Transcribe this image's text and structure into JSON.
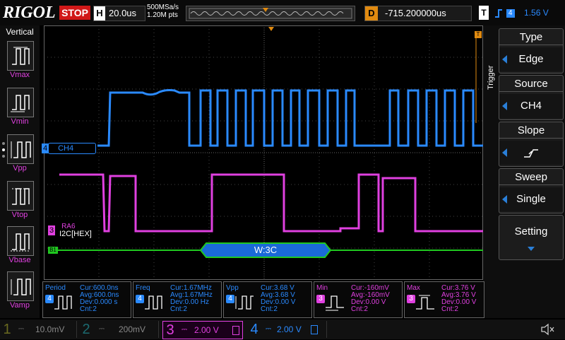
{
  "header": {
    "brand": "RIGOL",
    "run_status": "STOP",
    "timebase_key": "H",
    "timebase_value": "20.0us",
    "sample_rate": "500MSa/s",
    "memory_depth": "1.20M pts",
    "delay_key": "D",
    "delay_value": "-715.200000us",
    "trigger_key": "T",
    "trigger_source": "4",
    "trigger_level": "1.56 V"
  },
  "vertical_panel": {
    "title": "Vertical",
    "items": [
      {
        "label": "Vmax"
      },
      {
        "label": "Vmin"
      },
      {
        "label": "Vpp"
      },
      {
        "label": "Vtop"
      },
      {
        "label": "Vbase"
      },
      {
        "label": "Vamp"
      }
    ]
  },
  "display": {
    "ch4_label": "CH4",
    "ch4_marker": "4",
    "ch3_label": "RA6",
    "ch3_marker": "3",
    "decode_label": "I2C[HEX]",
    "bus_marker": "B1",
    "bus_packet": "W:3C",
    "trig_pos_marker": "T",
    "trig_level_marker": "T"
  },
  "trigger_menu": {
    "title": "Trigger",
    "items": [
      {
        "title": "Type",
        "value": "Edge"
      },
      {
        "title": "Source",
        "value": "CH4"
      },
      {
        "title": "Slope",
        "value": ""
      },
      {
        "title": "Sweep",
        "value": "Single"
      },
      {
        "title": "Setting",
        "value": ""
      }
    ]
  },
  "measurements": [
    {
      "name": "Period",
      "source": "4",
      "cur": "Cur:600.0ns",
      "avg": "Avg:600.0ns",
      "dev": "Dev:0.000 s",
      "cnt": "Cnt:2",
      "color": "#2a8aff"
    },
    {
      "name": "Freq",
      "source": "4",
      "cur": "Cur:1.67MHz",
      "avg": "Avg:1.67MHz",
      "dev": "Dev:0.00 Hz",
      "cnt": "Cnt:2",
      "color": "#2a8aff"
    },
    {
      "name": "Vpp",
      "source": "4",
      "cur": "Cur:3.68 V",
      "avg": "Avg:3.68 V",
      "dev": "Dev:0.00 V",
      "cnt": "Cnt:2",
      "color": "#2a8aff"
    },
    {
      "name": "Min",
      "source": "3",
      "cur": "Cur:-160mV",
      "avg": "Avg:-160mV",
      "dev": "Dev:0.00 V",
      "cnt": "Cnt:2",
      "color": "#e040e0"
    },
    {
      "name": "Max",
      "source": "3",
      "cur": "Cur:3.76 V",
      "avg": "Avg:3.76 V",
      "dev": "Dev:0.00 V",
      "cnt": "Cnt:2",
      "color": "#e040e0"
    }
  ],
  "channels": [
    {
      "num": "1",
      "scale": "10.0mV",
      "color": "#d8c800"
    },
    {
      "num": "2",
      "scale": "200mV",
      "color": "#20c8d8"
    },
    {
      "num": "3",
      "scale": "2.00 V",
      "color": "#e040e0"
    },
    {
      "num": "4",
      "scale": "2.00 V",
      "color": "#2a8aff"
    }
  ],
  "colors": {
    "ch3": "#e040e0",
    "ch4": "#2a8aff",
    "bus": "#20c820",
    "trigger": "#e08a10",
    "stop": "#d01818"
  }
}
